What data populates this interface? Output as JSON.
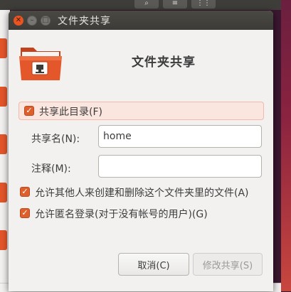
{
  "dialog": {
    "title": "文件夹共享",
    "header_title": "文件夹共享",
    "share_checkbox_label": "共享此目录(F)",
    "share_name_label": "共享名(N):",
    "share_name_value": "home",
    "comment_label": "注释(M):",
    "comment_value": "",
    "allow_others_label": "允许其他人来创建和删除这个文件夹里的文件(A)",
    "guest_access_label": "允许匿名登录(对于没有帐号的用户)(G)",
    "cancel_label": "取消(C)",
    "modify_label": "修改共享(S)",
    "share_checked": true,
    "allow_others_checked": true,
    "guest_access_checked": true
  },
  "colors": {
    "accent": "#dd5f2b",
    "titlebar": "#3c3b37",
    "dialog_bg": "#f2f1f0",
    "highlight_row": "#fbe6df"
  },
  "icons": {
    "close": "close-icon",
    "minimize": "minimize-icon",
    "maximize": "maximize-icon",
    "folder": "shared-folder-icon",
    "check": "check-icon"
  }
}
